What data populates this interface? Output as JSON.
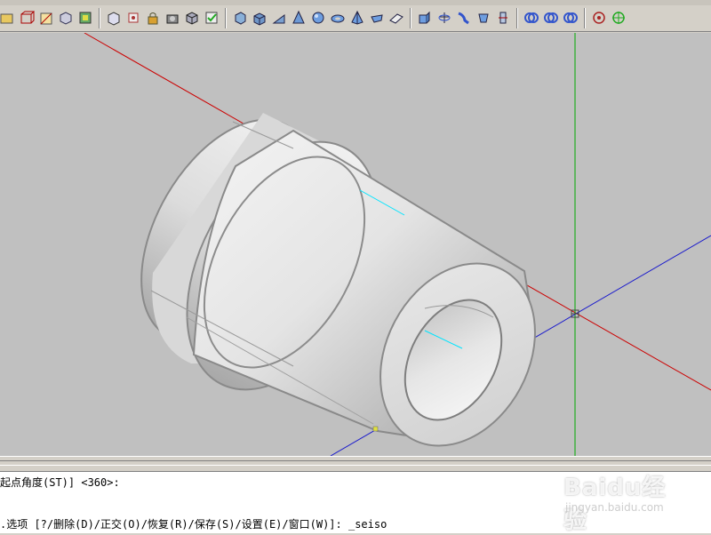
{
  "toolbar": {
    "groups": [
      [
        "open-icon",
        "box-wire-icon",
        "view-icon",
        "view3d-icon",
        "zoom-icon"
      ],
      [
        "box-view-icon",
        "clip-icon",
        "lock-icon",
        "camera-icon",
        "cube-icon",
        "check-icon"
      ],
      [
        "box-solid-icon",
        "cube-solid-icon",
        "wedge-icon",
        "cone-icon",
        "sphere-icon",
        "torus-icon",
        "pyramid-icon",
        "dish-icon",
        "mesh-icon"
      ],
      [
        "extrude-icon",
        "revolve-icon",
        "sweep-icon",
        "loft-icon",
        "slice-icon"
      ],
      [
        "union-icon",
        "subtract-icon",
        "intersect-icon"
      ],
      [
        "orbit-icon",
        "target-icon"
      ]
    ]
  },
  "command": {
    "line1": "起点角度(ST)] <360>:",
    "line2": ".选项 [?/删除(D)/正交(O)/恢复(R)/保存(S)/设置(E)/窗口(W)]: _seiso"
  },
  "watermark": {
    "text": "Baidu经验",
    "url": "jingyan.baidu.com"
  },
  "colors": {
    "viewport_bg": "#c0c0c0",
    "x_axis": "#cc0000",
    "y_axis": "#00aa00",
    "z_axis": "#0000cc",
    "highlight": "#00e5ff"
  }
}
